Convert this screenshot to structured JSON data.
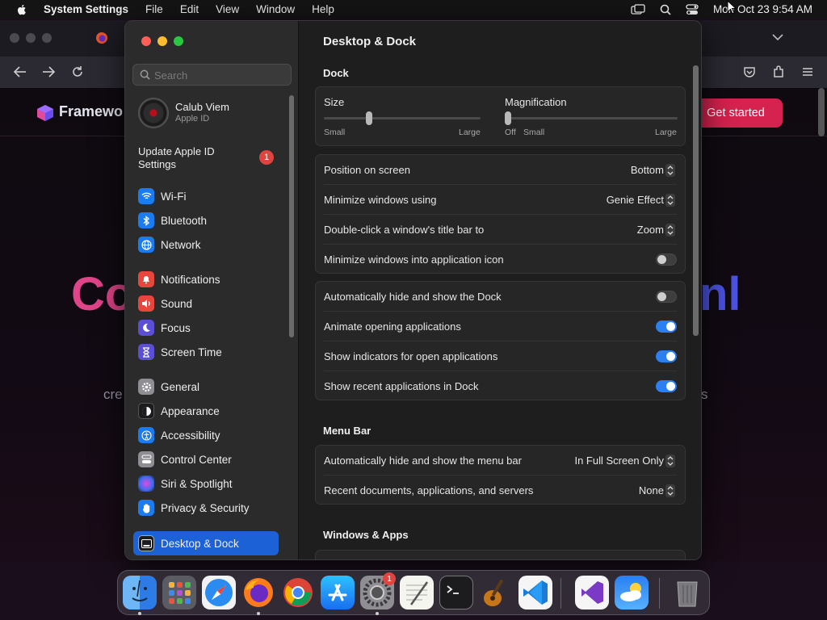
{
  "menubar": {
    "app_name": "System Settings",
    "items": [
      "File",
      "Edit",
      "View",
      "Window",
      "Help"
    ],
    "clock": "Mon Oct 23  9:54 AM"
  },
  "browser": {
    "brand": "Framewo",
    "cta": "Get started",
    "hero_left": "Co",
    "hero_right": "nl",
    "sub_left": "cre",
    "sub_right": "s"
  },
  "sidebar": {
    "search_placeholder": "Search",
    "user": {
      "name": "Calub Viem",
      "sub": "Apple ID"
    },
    "update": {
      "label": "Update Apple ID Settings",
      "badge": "1"
    },
    "items": [
      {
        "label": "Wi-Fi",
        "icon": "wifi-icon",
        "color": "#1a7cf0"
      },
      {
        "label": "Bluetooth",
        "icon": "bluetooth-icon",
        "color": "#1a7cf0"
      },
      {
        "label": "Network",
        "icon": "globe-icon",
        "color": "#1a7cf0"
      },
      {
        "label": "Notifications",
        "icon": "bell-icon",
        "color": "#e8453c"
      },
      {
        "label": "Sound",
        "icon": "speaker-icon",
        "color": "#e8453c"
      },
      {
        "label": "Focus",
        "icon": "moon-icon",
        "color": "#5b4fd6"
      },
      {
        "label": "Screen Time",
        "icon": "hourglass-icon",
        "color": "#5b4fd6"
      },
      {
        "label": "General",
        "icon": "gear-icon",
        "color": "#8e8e93"
      },
      {
        "label": "Appearance",
        "icon": "appearance-icon",
        "color": "#1c1c1e"
      },
      {
        "label": "Accessibility",
        "icon": "accessibility-icon",
        "color": "#1a7cf0"
      },
      {
        "label": "Control Center",
        "icon": "control-center-icon",
        "color": "#8e8e93"
      },
      {
        "label": "Siri & Spotlight",
        "icon": "siri-icon",
        "color": "#8e3fd6"
      },
      {
        "label": "Privacy & Security",
        "icon": "hand-icon",
        "color": "#1a7cf0"
      },
      {
        "label": "Desktop & Dock",
        "icon": "dock-icon",
        "color": "#1c1c1e"
      }
    ]
  },
  "content": {
    "title": "Desktop & Dock",
    "dock_header": "Dock",
    "size": {
      "label": "Size",
      "min": "Small",
      "max": "Large",
      "value": 0.28
    },
    "magnification": {
      "label": "Magnification",
      "off": "Off",
      "min": "Small",
      "max": "Large",
      "value": 0.0
    },
    "group1": [
      {
        "label": "Position on screen",
        "value": "Bottom"
      },
      {
        "label": "Minimize windows using",
        "value": "Genie Effect"
      },
      {
        "label": "Double-click a window's title bar to",
        "value": "Zoom"
      },
      {
        "label": "Minimize windows into application icon",
        "toggle": false
      }
    ],
    "group2": [
      {
        "label": "Automatically hide and show the Dock",
        "toggle": false
      },
      {
        "label": "Animate opening applications",
        "toggle": true
      },
      {
        "label": "Show indicators for open applications",
        "toggle": true
      },
      {
        "label": "Show recent applications in Dock",
        "toggle": true
      }
    ],
    "menubar_header": "Menu Bar",
    "group3": [
      {
        "label": "Automatically hide and show the menu bar",
        "value": "In Full Screen Only"
      },
      {
        "label": "Recent documents, applications, and servers",
        "value": "None"
      }
    ],
    "windows_header": "Windows & Apps"
  },
  "dock": {
    "apps": [
      "Finder",
      "Launchpad",
      "Safari",
      "Firefox",
      "Chrome",
      "App Store",
      "System Settings",
      "TextEdit",
      "Terminal",
      "GarageBand",
      "VS Code",
      "Visual Studio",
      "Weather",
      "Trash"
    ],
    "settings_badge": "1"
  }
}
